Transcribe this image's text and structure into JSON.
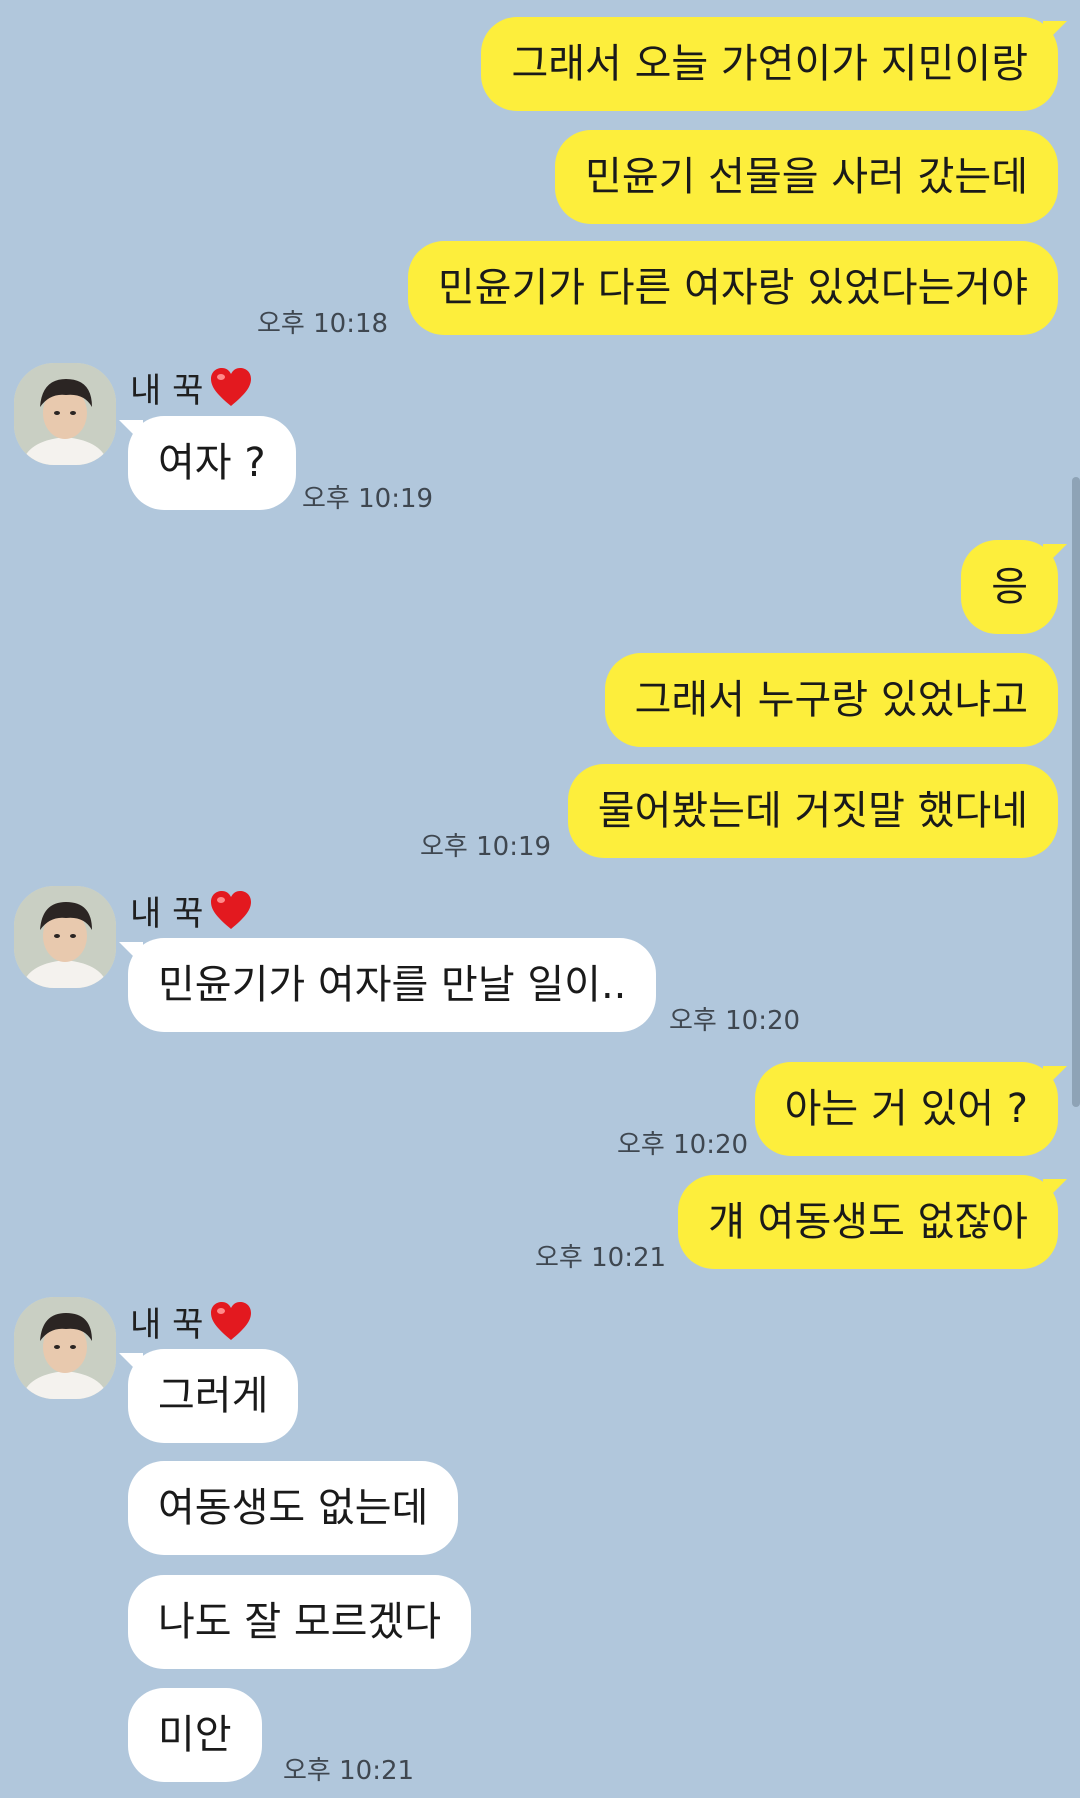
{
  "contact": {
    "name": "내 꾹",
    "avatar_icon": "profile-photo"
  },
  "colors": {
    "background": "#b1c7dc",
    "my_bubble": "#fdee3c",
    "their_bubble": "#ffffff",
    "timestamp": "#3f4750"
  },
  "messages": [
    {
      "from": "me",
      "text": "그래서 오늘 가연이가 지민이랑"
    },
    {
      "from": "me",
      "text": "민윤기 선물을 사러 갔는데"
    },
    {
      "from": "me",
      "text": "민윤기가 다른 여자랑 있었다는거야",
      "time": "오후 10:18"
    },
    {
      "from": "them",
      "text": "여자 ?",
      "time": "오후 10:19"
    },
    {
      "from": "me",
      "text": "응"
    },
    {
      "from": "me",
      "text": "그래서 누구랑 있었냐고"
    },
    {
      "from": "me",
      "text": "물어봤는데 거짓말 했다네",
      "time": "오후 10:19"
    },
    {
      "from": "them",
      "text": "민윤기가 여자를 만날 일이..",
      "time": "오후 10:20"
    },
    {
      "from": "me",
      "text": "아는 거 있어 ?",
      "time": "오후 10:20"
    },
    {
      "from": "me",
      "text": "걔 여동생도 없잖아",
      "time": "오후 10:21"
    },
    {
      "from": "them",
      "text": "그러게"
    },
    {
      "from": "them",
      "text": "여동생도 없는데"
    },
    {
      "from": "them",
      "text": "나도 잘 모르겠다"
    },
    {
      "from": "them",
      "text": "미안",
      "time": "오후 10:21"
    }
  ]
}
